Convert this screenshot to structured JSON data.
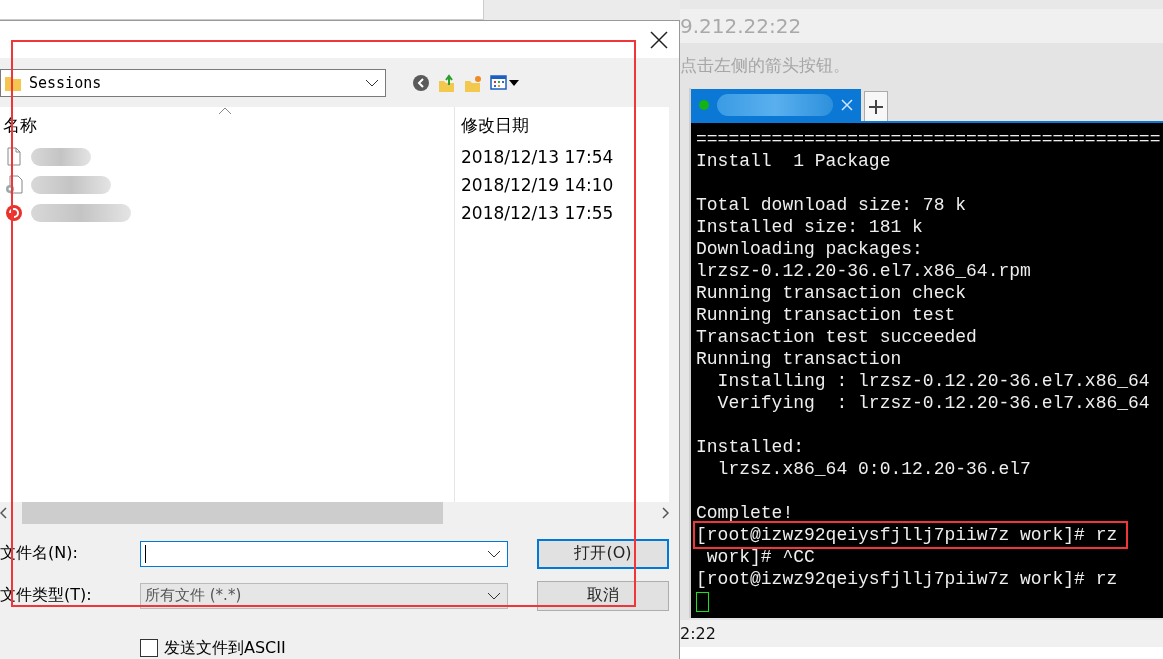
{
  "dialog": {
    "location": "Sessions",
    "columns": [
      "名称",
      "修改日期"
    ],
    "files": [
      {
        "kind": "document",
        "modified": "2018/12/13 17:54"
      },
      {
        "kind": "config",
        "modified": "2018/12/19 14:10"
      },
      {
        "kind": "session",
        "modified": "2018/12/13 17:55"
      }
    ],
    "filename_label": "文件名(N):",
    "filetype_label": "文件类型(T):",
    "filetype": "所有文件 (*.*)",
    "buttons": [
      {
        "label": "打开(O)",
        "default": true
      },
      {
        "label": "取消",
        "default": false
      }
    ],
    "ascii_checkbox": {
      "label": "发送文件到ASCII",
      "checked": false
    }
  },
  "host_window": {
    "address": "9.212.22:22",
    "hint": "点击左侧的箭头按钮。",
    "status": "2:22"
  },
  "terminal": {
    "tabs": [
      {
        "selected": true,
        "connected": true
      }
    ],
    "lines": [
      {
        "kind": "text",
        "text": "===========================================",
        "annotated": false
      },
      {
        "kind": "text",
        "text": "Install  1 Package",
        "annotated": false
      },
      {
        "kind": "blank"
      },
      {
        "kind": "text",
        "text": "Total download size: 78 k",
        "annotated": false
      },
      {
        "kind": "text",
        "text": "Installed size: 181 k",
        "annotated": false
      },
      {
        "kind": "text",
        "text": "Downloading packages:",
        "annotated": false
      },
      {
        "kind": "text",
        "text": "lrzsz-0.12.20-36.el7.x86_64.rpm",
        "annotated": false
      },
      {
        "kind": "text",
        "text": "Running transaction check",
        "annotated": false
      },
      {
        "kind": "text",
        "text": "Running transaction test",
        "annotated": false
      },
      {
        "kind": "text",
        "text": "Transaction test succeeded",
        "annotated": false
      },
      {
        "kind": "text",
        "text": "Running transaction",
        "annotated": false
      },
      {
        "kind": "text",
        "text": "  Installing : lrzsz-0.12.20-36.el7.x86_64",
        "annotated": false
      },
      {
        "kind": "text",
        "text": "  Verifying  : lrzsz-0.12.20-36.el7.x86_64",
        "annotated": false
      },
      {
        "kind": "blank"
      },
      {
        "kind": "text",
        "text": "Installed:",
        "annotated": false
      },
      {
        "kind": "text",
        "text": "  lrzsz.x86_64 0:0.12.20-36.el7",
        "annotated": false
      },
      {
        "kind": "blank"
      },
      {
        "kind": "text",
        "text": "Complete!",
        "annotated": false
      },
      {
        "kind": "text",
        "text": "[root@izwz92qeiysfjllj7piiw7z work]# rz",
        "annotated": true
      },
      {
        "kind": "text",
        "text": " work]# ^CC",
        "annotated": false
      },
      {
        "kind": "text",
        "text": "[root@izwz92qeiysfjllj7piiw7z work]# rz",
        "annotated": false
      },
      {
        "kind": "cursor"
      }
    ]
  }
}
